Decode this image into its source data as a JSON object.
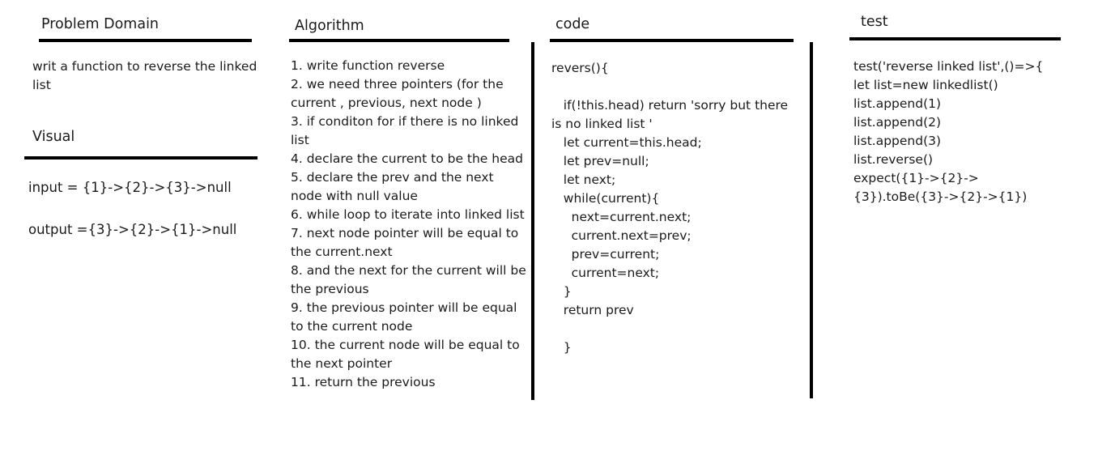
{
  "problem_domain": {
    "title": "Problem Domain",
    "body": "writ a function to reverse the linked list"
  },
  "visual": {
    "title": "Visual",
    "input": "input = {1}->{2}->{3}->null",
    "output": "output ={3}->{2}->{1}->null"
  },
  "algorithm": {
    "title": "Algorithm",
    "steps": [
      "1. write function  reverse",
      "2. we need three pointers (for the current , previous, next node )",
      "3. if conditon for if there is no linked list",
      "4. declare the current to be the head",
      "5. declare the prev and the next node with null value",
      "6. while loop to iterate into linked list",
      "7. next node pointer will be equal to the current.next",
      "8. and the next for the current will be the previous",
      "9. the previous pointer will be equal to the current node",
      "10. the current node will be equal to the next pointer",
      "11. return the previous"
    ]
  },
  "code": {
    "title": "code",
    "lines": [
      "revers(){",
      "",
      "   if(!this.head) return 'sorry but there is no linked list '",
      "   let current=this.head;",
      "   let prev=null;",
      "   let next;",
      "   while(current){",
      "     next=current.next;",
      "     current.next=prev;",
      "     prev=current;",
      "     current=next;",
      "   }",
      "   return prev",
      "",
      "   }"
    ]
  },
  "test": {
    "title": "test",
    "lines": [
      "test('reverse linked list',()=>{",
      "let list=new linkedlist()",
      "list.append(1)",
      "list.append(2)",
      "list.append(3)",
      "list.reverse()",
      "expect({1}->{2}->{3}).toBe({3}->{2}->{1})"
    ]
  }
}
